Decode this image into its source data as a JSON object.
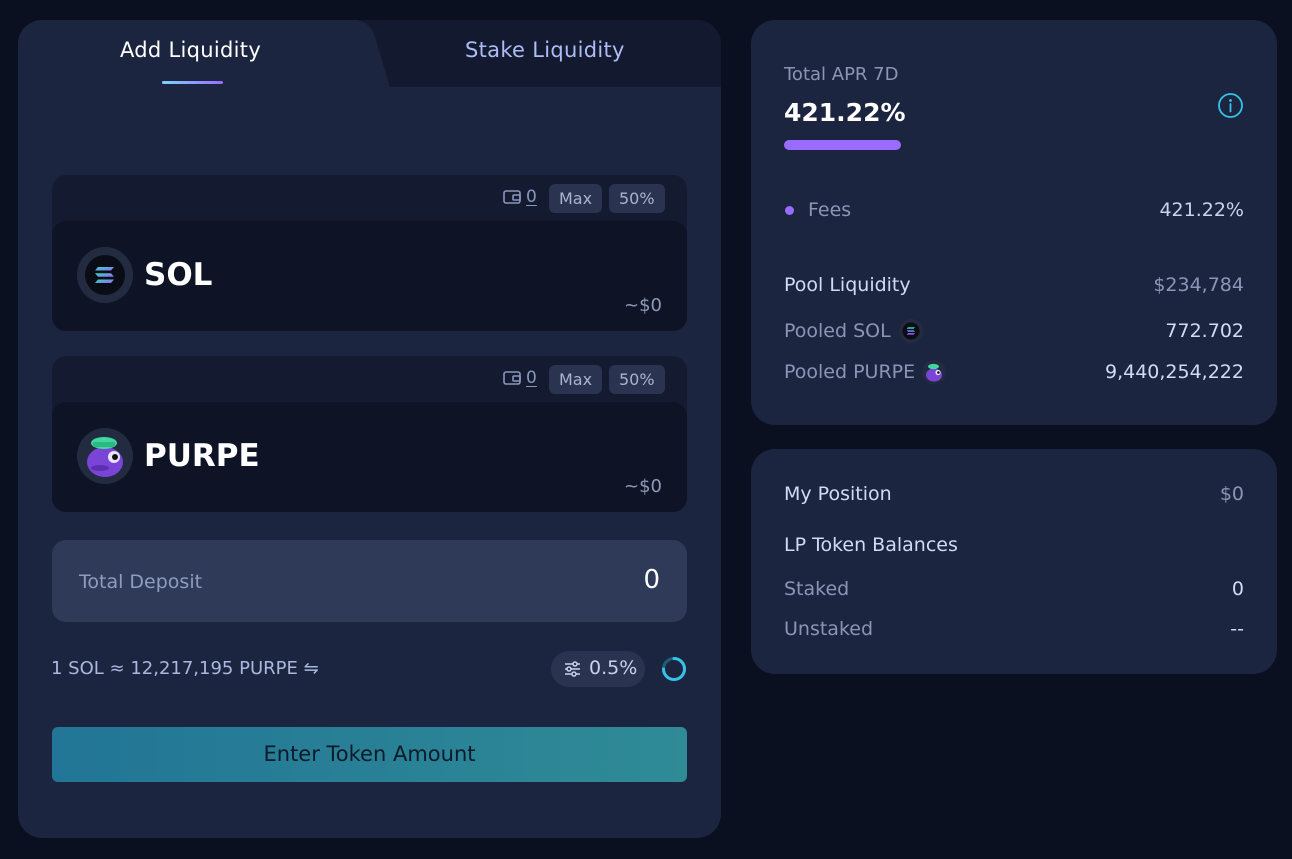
{
  "tabs": {
    "add_label": "Add Liquidity",
    "stake_label": "Stake Liquidity"
  },
  "tokens": [
    {
      "symbol": "SOL",
      "wallet_balance": "0",
      "max_label": "Max",
      "half_label": "50%",
      "usd_value": "~$0",
      "icon": "solana-logo-icon"
    },
    {
      "symbol": "PURPE",
      "wallet_balance": "0",
      "max_label": "Max",
      "half_label": "50%",
      "usd_value": "~$0",
      "icon": "purpe-frog-logo-icon"
    }
  ],
  "total_deposit": {
    "label": "Total Deposit",
    "value": "0"
  },
  "rate_text": "1 SOL ≈ 12,217,195 PURPE ⇋",
  "slippage": "0.5%",
  "enter_button": "Enter Token Amount",
  "apr": {
    "label": "Total APR 7D",
    "value": "421.22%",
    "bar_fraction": 1.0,
    "fees_label": "Fees",
    "fees_value": "421.22%"
  },
  "pool": {
    "liquidity_label": "Pool Liquidity",
    "liquidity_value": "$234,784",
    "pooled_sol_label": "Pooled SOL",
    "pooled_sol_value": "772.702",
    "pooled_purpe_label": "Pooled PURPE",
    "pooled_purpe_value": "9,440,254,222"
  },
  "position": {
    "label": "My Position",
    "value": "$0",
    "lp_label": "LP Token Balances",
    "staked_label": "Staked",
    "staked_value": "0",
    "unstaked_label": "Unstaked",
    "unstaked_value": "--"
  },
  "colors": {
    "accent_purple": "#9a6bff",
    "accent_cyan": "#36c3e8",
    "button_teal": "#227596",
    "panel_bg": "#1c2540",
    "page_bg": "#0b1020"
  }
}
